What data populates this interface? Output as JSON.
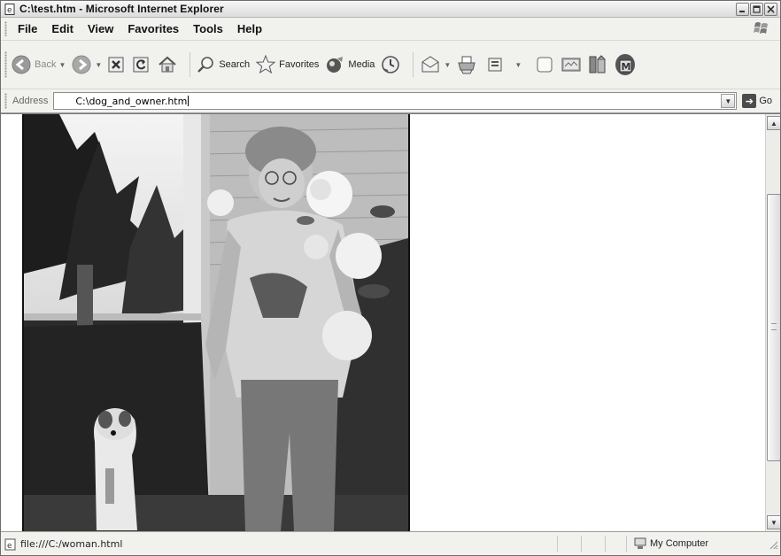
{
  "window": {
    "title": "C:\\test.htm - Microsoft Internet Explorer"
  },
  "menu": [
    "File",
    "Edit",
    "View",
    "Favorites",
    "Tools",
    "Help"
  ],
  "toolbar": {
    "back_label": "Back",
    "search_label": "Search",
    "favorites_label": "Favorites",
    "media_label": "Media"
  },
  "address": {
    "label": "Address",
    "value": "C:\\dog_and_owner.htm",
    "go_label": "Go"
  },
  "status": {
    "text": "file:///C:/woman.html",
    "zone": "My Computer"
  },
  "icons": {
    "app": "ie-page-icon",
    "back": "back-arrow-icon",
    "forward": "forward-arrow-icon",
    "stop": "stop-icon",
    "refresh": "refresh-icon",
    "home": "home-icon",
    "search": "search-icon",
    "favorites": "star-icon",
    "media": "media-icon",
    "history": "history-icon",
    "mail": "mail-icon",
    "print": "printer-icon",
    "edit": "edit-icon",
    "discuss": "discuss-icon",
    "messenger": "messenger-icon",
    "research": "research-icon",
    "toolbar-m": "m-logo-icon"
  }
}
